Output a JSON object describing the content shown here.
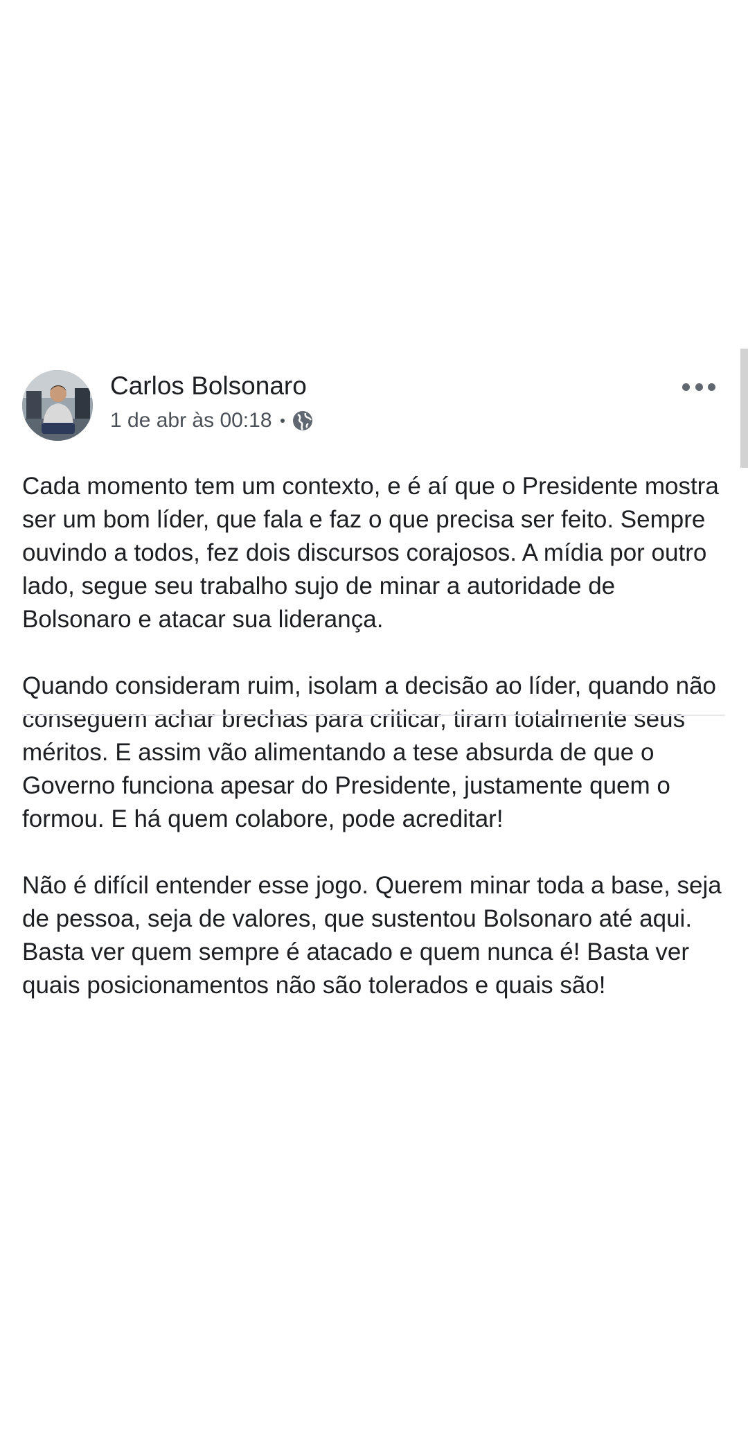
{
  "post": {
    "author": "Carlos Bolsonaro",
    "timestamp": "1 de abr às 00:18",
    "privacy_icon": "globe-icon",
    "more_icon": "more-options-icon",
    "paragraphs": [
      "Cada momento tem um contexto, e é aí que o Presidente mostra ser um bom líder, que fala e faz o que precisa ser feito. Sempre ouvindo a todos, fez dois discursos corajosos. A mídia por outro lado, segue seu trabalho sujo de minar a autoridade de Bolsonaro e atacar sua liderança.",
      "Quando consideram ruim, isolam a decisão ao líder, quando não conseguem achar brechas para criticar, tiram totalmente seus méritos. E assim vão alimentando a tese absurda de que o Governo funciona apesar do Presidente, justamente quem o formou. E há quem colabore, pode acreditar!",
      "Não é difícil entender esse jogo. Querem minar toda a base, seja de pessoa, seja de valores, que sustentou Bolsonaro até aqui. Basta ver quem sempre é atacado e quem nunca é! Basta ver quais posicionamentos não são tolerados e quais são!"
    ]
  },
  "colors": {
    "text": "#1c1e21",
    "secondary_text": "#4b4f56",
    "divider": "#e4e6eb"
  }
}
